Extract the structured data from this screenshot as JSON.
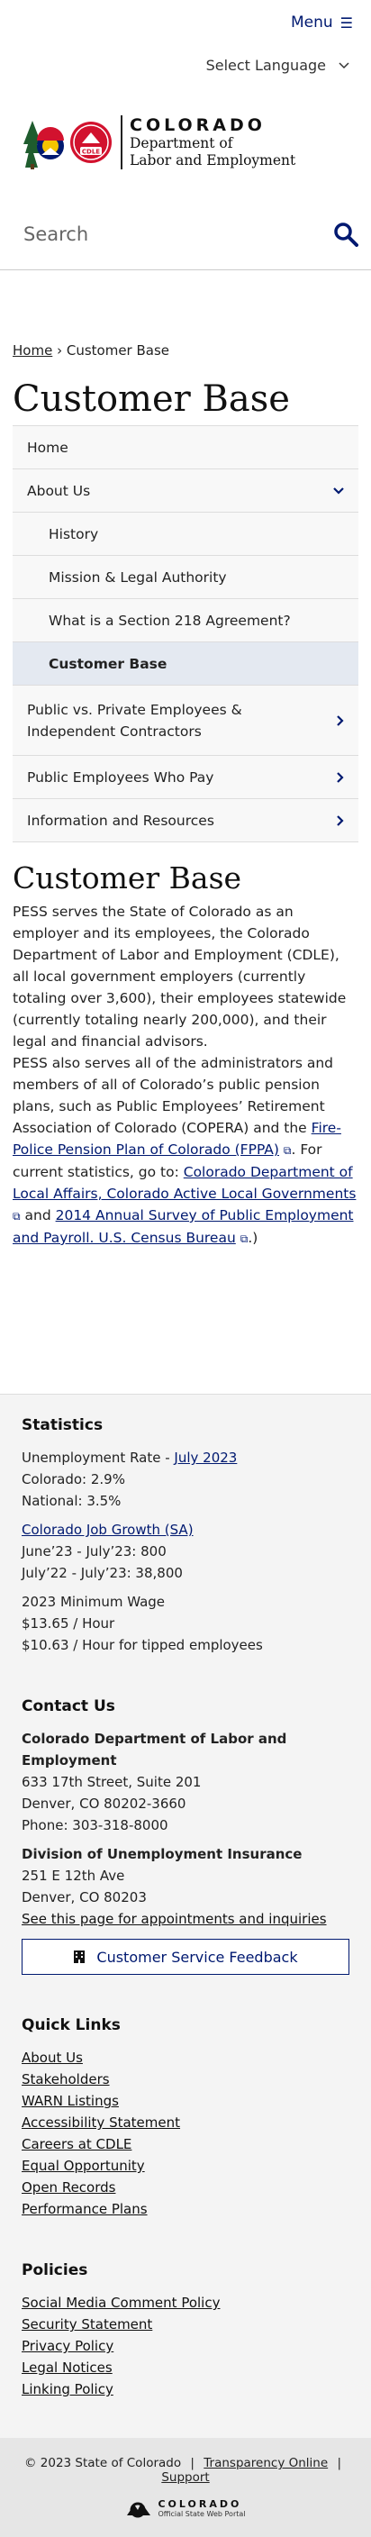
{
  "header": {
    "menu_label": "Menu",
    "language_label": "Select Language",
    "logo": {
      "state": "COLORADO",
      "dept_line1": "Department of",
      "dept_line2": "Labor and Employment",
      "badge": "CDLE"
    },
    "search_placeholder": "Search"
  },
  "breadcrumb": {
    "home": "Home",
    "separator": "›",
    "current": "Customer Base"
  },
  "page_title": "Customer Base",
  "sidenav": {
    "home": "Home",
    "about": "About Us",
    "history": "History",
    "mission": "Mission & Legal Authority",
    "section218": "What is a Section 218 Agreement?",
    "customer_base": "Customer Base",
    "public_private": "Public vs. Private Employees & Independent Contractors",
    "who_pay": "Public Employees Who Pay",
    "info": "Information and Resources"
  },
  "content": {
    "title": "Customer Base",
    "p1_a": "PESS serves the State of Colorado as an employer and its employees, the Colorado Department of Labor and Employment (CDLE), all local government employers (currently totaling over 3,600), their employees statewide (currently totaling nearly 200,000), and their legal and financial advisors.",
    "p1_b": "PESS also serves all of the administrators and members of all of Colorado’s public pension plans, such as Public Employees’ Retirement Association of Colorado (COPERA) and the ",
    "link_fppa": "Fire-Police Pension Plan of Colorado (FPPA)",
    "p1_c": ".   For current statistics, go to: ",
    "link_dola": "Colorado Department of Local Affairs, Colorado Active Local Governments",
    "p1_d": " and ",
    "link_census": "2014 Annual Survey of Public Employment and Payroll. U.S. Census Bureau",
    "p1_e": ".)"
  },
  "footer": {
    "stats_title": "Statistics",
    "unemp_label": "Unemployment Rate - ",
    "unemp_link": "July 2023",
    "co_rate": "Colorado: 2.9%",
    "nat_rate": "National: 3.5%",
    "job_link": "Colorado Job Growth (SA)",
    "job1": "June’23 - July’23: 800",
    "job2": "July’22 - July’23: 38,800",
    "wage_title": "2023 Minimum Wage",
    "wage1": "$13.65 / Hour",
    "wage2": "$10.63 / Hour for tipped employees",
    "contact_title": "Contact Us",
    "cdle_name": "Colorado Department of Labor and Employment",
    "cdle_addr1": "633 17th Street, Suite 201",
    "cdle_addr2": "Denver, CO  80202-3660",
    "cdle_phone": "Phone: 303-318-8000",
    "dui_name": "Division of Unemployment Insurance",
    "dui_addr1": "251 E 12th Ave",
    "dui_addr2": "Denver, CO  80203",
    "dui_link": "See this page for appointments and inquiries",
    "feedback": "Customer Service Feedback",
    "quick_title": "Quick Links",
    "quick_links": [
      "About Us",
      "Stakeholders",
      "WARN Listings",
      "Accessibility Statement",
      "Careers at CDLE",
      "Equal Opportunity",
      "Open Records",
      "Performance Plans"
    ],
    "policies_title": "Policies",
    "policy_links": [
      "Social Media Comment Policy",
      "Security Statement",
      "Privacy Policy",
      "Legal Notices",
      "Linking Policy"
    ],
    "copyright": "© 2023 State of Colorado",
    "sep": "|",
    "transparency": "Transparency Online",
    "support": "Support",
    "portal_name": "COLORADO",
    "portal_sub": "Official State Web Portal"
  },
  "colors": {
    "navy": "#001970",
    "red": "#d2122e",
    "gold": "#f5c400"
  },
  "icons": [
    "hamburger-icon",
    "chevron-down-icon",
    "search-icon",
    "chevron-right-icon",
    "external-link-icon",
    "building-icon"
  ]
}
